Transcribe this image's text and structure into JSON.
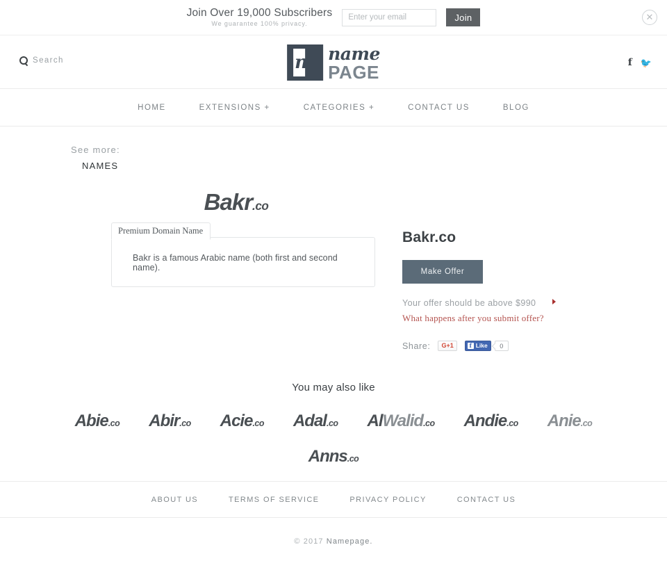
{
  "subscribe": {
    "title": "Join Over 19,000 Subscribers",
    "subtitle": "We guarantee 100% privacy.",
    "email_placeholder": "Enter your email",
    "email_value": "",
    "join_label": "Join",
    "close_icon": "close-circle-icon"
  },
  "header": {
    "search_label": "Search",
    "search_icon": "search-icon",
    "logo": {
      "mark_letter": "n",
      "name": "name",
      "page": "PAGE"
    },
    "social": [
      {
        "name": "facebook-icon",
        "glyph": "f"
      },
      {
        "name": "twitter-icon",
        "glyph": "🐦"
      }
    ]
  },
  "nav": {
    "items": [
      {
        "label": "HOME"
      },
      {
        "label": "EXTENSIONS +"
      },
      {
        "label": "CATEGORIES +"
      },
      {
        "label": "CONTACT US"
      },
      {
        "label": "BLOG"
      }
    ]
  },
  "see_more": {
    "label": "See more:",
    "value": "NAMES"
  },
  "product": {
    "hero_name": "Bakr",
    "hero_tld": ".co",
    "panel_tab": "Premium Domain Name",
    "panel_body": "Bakr is a famous Arabic name (both first and second name).",
    "title": "Bakr.co",
    "offer_button": "Make Offer",
    "offer_note": "Your offer should be above $990",
    "offer_link": "What happens after you submit offer?",
    "share_label": "Share:",
    "gplus_label": "G+1",
    "fb_like_label": "Like",
    "fb_like_count": "0"
  },
  "also_like": {
    "title": "You may also like",
    "rows": [
      [
        {
          "name": "Abie",
          "tld": ".co"
        },
        {
          "name": "Abir",
          "tld": ".co"
        },
        {
          "name": "Acie",
          "tld": ".co"
        },
        {
          "name": "Adal",
          "tld": ".co"
        },
        {
          "name": "AlWalid",
          "tld": ".co",
          "prefix": "Al",
          "suffix": "Walid"
        },
        {
          "name": "Andie",
          "tld": ".co"
        },
        {
          "name": "Anie",
          "tld": ".co"
        }
      ],
      [
        {
          "name": "Anns",
          "tld": ".co"
        }
      ]
    ]
  },
  "footer": {
    "links": [
      {
        "label": "ABOUT US"
      },
      {
        "label": "TERMS OF SERVICE"
      },
      {
        "label": "PRIVACY POLICY"
      },
      {
        "label": "CONTACT US"
      }
    ],
    "copyright_year": "© 2017",
    "copyright_name": "Namepage."
  },
  "colors": {
    "logo_dark": "#3f4a56",
    "offer_button": "#5b6b78",
    "join_button": "#5d6164",
    "accent_red": "#b4534f",
    "fb_blue": "#4267b2",
    "gplus_red": "#d14836"
  }
}
